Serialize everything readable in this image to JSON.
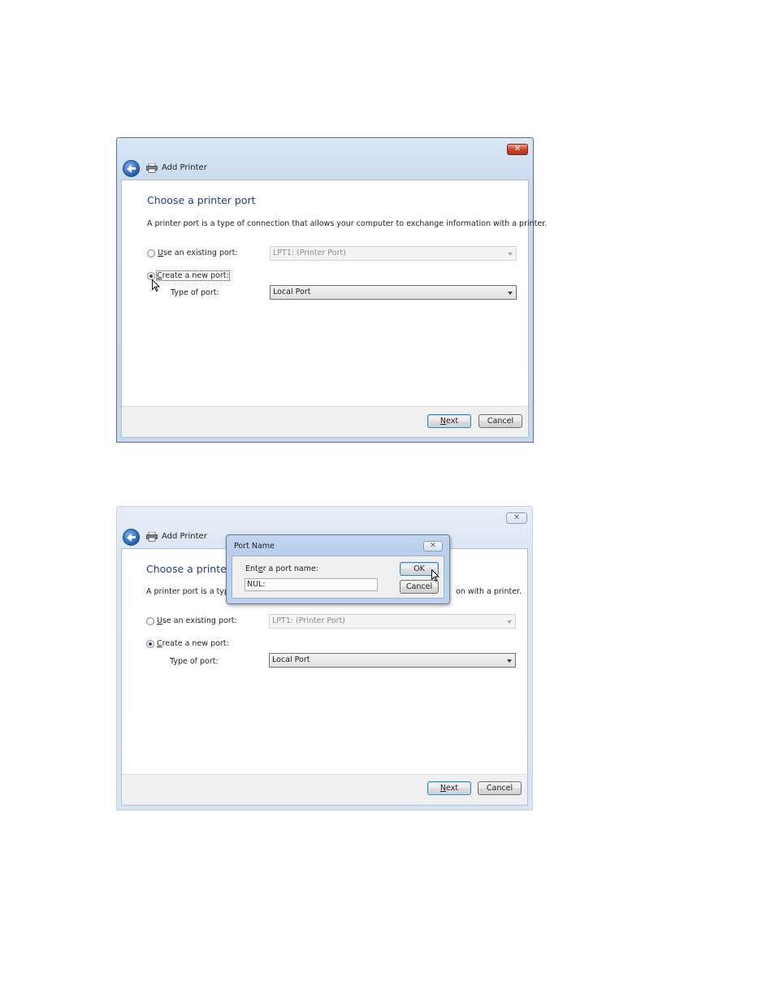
{
  "screens": [
    {
      "window": {
        "title": "Add Printer",
        "close_glyph": "✕",
        "heading": "Choose a printer port",
        "description": "A printer port is a type of connection that allows your computer to exchange information with a printer.",
        "existing_port": {
          "label_mnemonic": "U",
          "label_rest": "se an existing port:",
          "selected": false,
          "value": "LPT1: (Printer Port)",
          "enabled": false
        },
        "new_port": {
          "label_mnemonic": "C",
          "label_rest": "reate a new port:",
          "selected": true
        },
        "type_of_port": {
          "label": "Type of port:",
          "value": "Local Port"
        },
        "next_button": {
          "mnemonic": "N",
          "rest": "ext"
        },
        "cancel_button": "Cancel"
      }
    },
    {
      "window": {
        "title": "Add Printer",
        "close_glyph": "✕",
        "heading": "Choose a printer",
        "description_left": "A printer port is a type",
        "description_right": "on with a printer.",
        "existing_port": {
          "label_mnemonic": "U",
          "label_rest": "se an existing port:",
          "selected": false,
          "value": "LPT1: (Printer Port)",
          "enabled": false
        },
        "new_port": {
          "label_mnemonic": "C",
          "label_rest": "reate a new port:",
          "selected": true
        },
        "type_of_port": {
          "label": "Type of port:",
          "value": "Local Port"
        },
        "next_button": {
          "mnemonic": "N",
          "rest": "ext"
        },
        "cancel_button": "Cancel"
      },
      "dialog": {
        "title": "Port Name",
        "close_glyph": "✕",
        "prompt_pre": "Ent",
        "prompt_mnemonic": "e",
        "prompt_post": "r a port name:",
        "port_name_value": "NUL:",
        "ok_button": "OK",
        "cancel_button": "Cancel"
      }
    }
  ],
  "icons": {
    "back": "back-arrow-icon",
    "printer": "printer-icon",
    "cursor": "mouse-pointer-icon",
    "close": "close-icon"
  },
  "colors": {
    "heading": "#1e3c96",
    "active_frame": "#c9daf0",
    "close_button_active": "#c9462b",
    "default_button_border": "#3c7fb1"
  }
}
